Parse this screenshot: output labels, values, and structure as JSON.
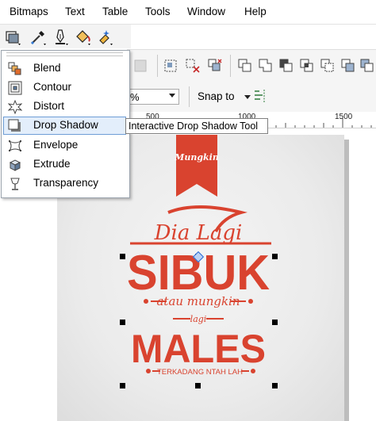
{
  "menubar": {
    "items": [
      "Bitmaps",
      "Text",
      "Table",
      "Tools",
      "Window",
      "Help"
    ]
  },
  "flyout": {
    "items": [
      {
        "label": "Blend",
        "icon": "blend-icon"
      },
      {
        "label": "Contour",
        "icon": "contour-icon"
      },
      {
        "label": "Distort",
        "icon": "distort-icon"
      },
      {
        "label": "Drop Shadow",
        "icon": "drop-shadow-icon",
        "selected": true
      },
      {
        "label": "Envelope",
        "icon": "envelope-icon"
      },
      {
        "label": "Extrude",
        "icon": "extrude-icon"
      },
      {
        "label": "Transparency",
        "icon": "transparency-icon"
      }
    ]
  },
  "tooltip": "Interactive Drop Shadow Tool",
  "propbar": {
    "opacity_value": "%",
    "snap_label": "Snap to"
  },
  "ruler": {
    "labels": [
      "500",
      "1000",
      "1500"
    ]
  },
  "artwork": {
    "ribbon_text": "Mungkin",
    "script_line": "Dia Lagi",
    "big_line_1": "SIBUK",
    "small_line": "atau mungkin",
    "lagi_small": "lagi",
    "big_line_2": "MALES",
    "bottom_line": "TERKADANG NTAH LAH"
  },
  "colors": {
    "brand_red": "#d9432f",
    "selection_blue": "#6e9ed6"
  }
}
